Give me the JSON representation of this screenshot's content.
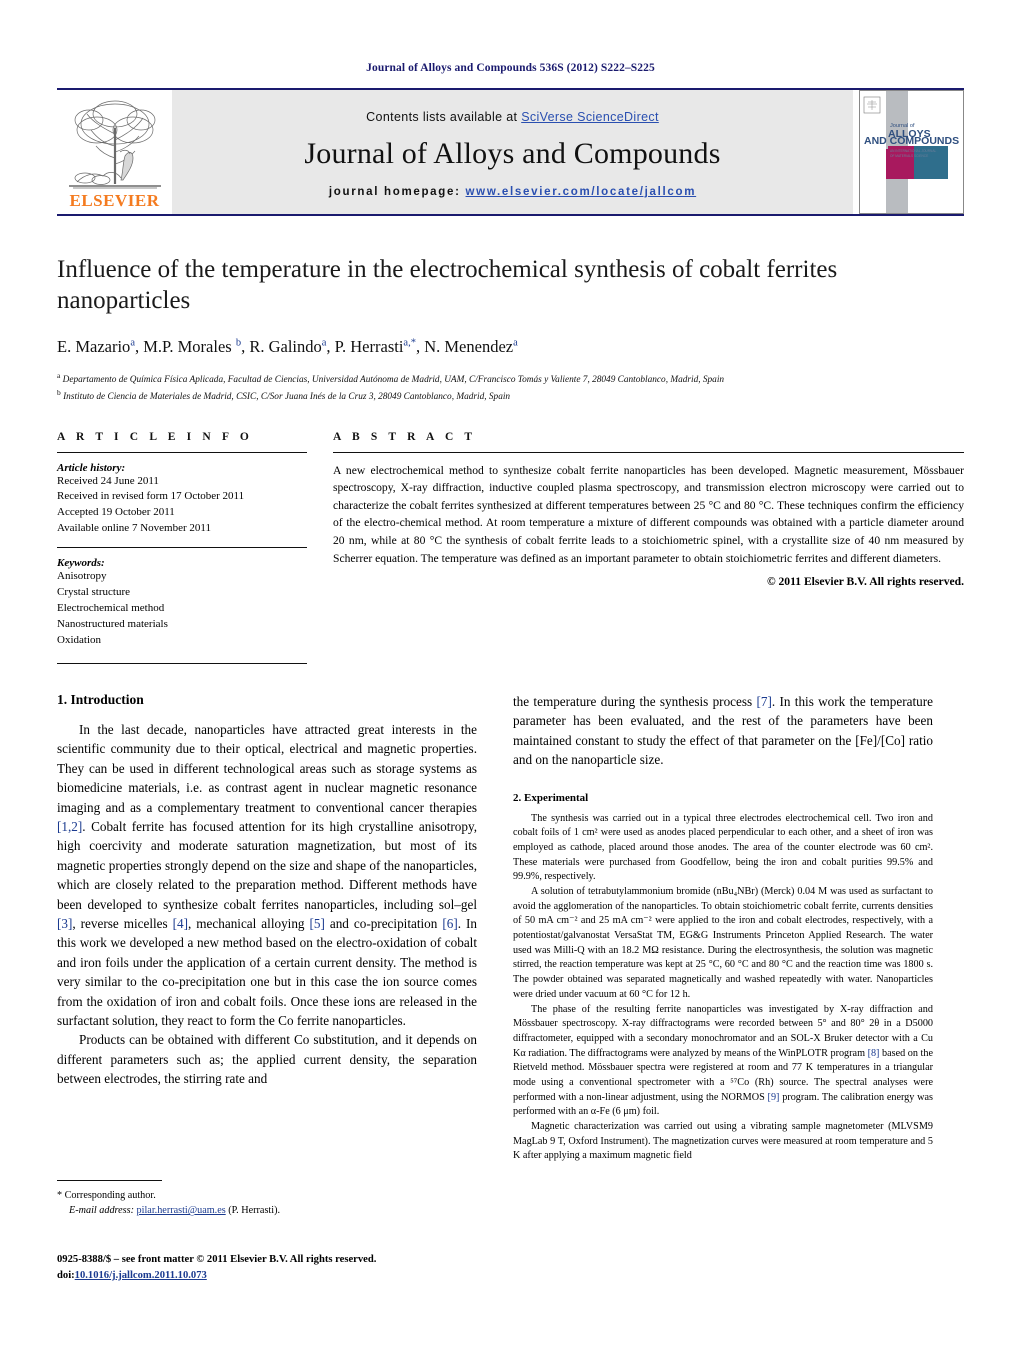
{
  "running_head": "Journal of Alloys and Compounds 536S (2012) S222–S225",
  "masthead": {
    "publisher_logo_word": "ELSEVIER",
    "contents_prefix": "Contents lists available at ",
    "contents_link": "SciVerse ScienceDirect",
    "journal_name": "Journal of Alloys and Compounds",
    "homepage_prefix": "journal homepage: ",
    "homepage_url": "www.elsevier.com/locate/jallcom",
    "cover": {
      "line1": "Journal of",
      "line2": "ALLOYS",
      "line3": "AND COMPOUNDS",
      "logo_word": "ELSEVIER"
    }
  },
  "article": {
    "title": "Influence of the temperature in the electrochemical synthesis of cobalt ferrites nanoparticles",
    "authors_html": "E. Mazario<sup>a</sup>, M.P. Morales <sup>b</sup>, R. Galindo<sup>a</sup>, P. Herrasti<sup>a,*</sup>, N. Menendez<sup>a</sup>",
    "affiliations": [
      "Departamento de Química Física Aplicada, Facultad de Ciencias, Universidad Autónoma de Madrid, UAM, C/Francisco Tomás y Valiente 7, 28049 Cantoblanco, Madrid, Spain",
      "Instituto de Ciencia de Materiales de Madrid, CSIC, C/Sor Juana Inés de la Cruz 3, 28049 Cantoblanco, Madrid, Spain"
    ],
    "affiliation_marks": [
      "a",
      "b"
    ]
  },
  "article_info": {
    "heading": "A R T I C L E    I N F O",
    "history_label": "Article history:",
    "history": [
      "Received 24 June 2011",
      "Received in revised form 17 October 2011",
      "Accepted 19 October 2011",
      "Available online 7 November 2011"
    ],
    "keywords_label": "Keywords:",
    "keywords": [
      "Anisotropy",
      "Crystal structure",
      "Electrochemical method",
      "Nanostructured materials",
      "Oxidation"
    ]
  },
  "abstract": {
    "heading": "A B S T R A C T",
    "text": "A new electrochemical method to synthesize cobalt ferrite nanoparticles has been developed. Magnetic measurement, Mössbauer spectroscopy, X-ray diffraction, inductive coupled plasma spectroscopy, and transmission electron microscopy were carried out to characterize the cobalt ferrites synthesized at different temperatures between 25 °C and 80 °C. These techniques confirm the efficiency of the electro-chemical method. At room temperature a mixture of different compounds was obtained with a particle diameter around 20 nm, while at 80 °C the synthesis of cobalt ferrite leads to a stoichiometric spinel, with a crystallite size of 40 nm measured by Scherrer equation. The temperature was defined as an important parameter to obtain stoichiometric ferrites and different diameters.",
    "copyright": "© 2011 Elsevier B.V. All rights reserved."
  },
  "sections": {
    "introduction_heading": "1.  Introduction",
    "intro_p1": "In the last decade, nanoparticles have attracted great interests in the scientific community due to their optical, electrical and magnetic properties. They can be used in different technological areas such as storage systems as biomedicine materials, i.e. as contrast agent in nuclear magnetic resonance imaging and as a complementary treatment to conventional cancer therapies [1,2]. Cobalt ferrite has focused attention for its high crystalline anisotropy, high coercivity and moderate saturation magnetization, but most of its magnetic properties strongly depend on the size and shape of the nanoparticles, which are closely related to the preparation method. Different methods have been developed to synthesize cobalt ferrites nanoparticles, including sol–gel [3], reverse micelles [4], mechanical alloying [5] and co-precipitation [6]. In this work we developed a new method based on the electro-oxidation of cobalt and iron foils under the application of a certain current density. The method is very similar to the co-precipitation one but in this case the ion source comes from the oxidation of iron and cobalt foils. Once these ions are released in the surfactant solution, they react to form the Co ferrite nanoparticles.",
    "intro_p2": "Products can be obtained with different Co substitution, and it depends on different parameters such as; the applied current density, the separation between electrodes, the stirring rate and",
    "intro_p3": "the temperature during the synthesis process [7]. In this work the temperature parameter has been evaluated, and the rest of the parameters have been maintained constant to study the effect of that parameter on the [Fe]/[Co] ratio and on the nanoparticle size.",
    "experimental_heading": "2.  Experimental",
    "exp_p1": "The synthesis was carried out in a typical three electrodes electrochemical cell. Two iron and cobalt foils of 1 cm² were used as anodes placed perpendicular to each other, and a sheet of iron was employed as cathode, placed around those anodes. The area of the counter electrode was 60 cm². These materials were purchased from Goodfellow, being the iron and cobalt purities 99.5% and 99.9%, respectively.",
    "exp_p2": "A solution of tetrabutylammonium bromide (nBu₄NBr) (Merck) 0.04 M was used as surfactant to avoid the agglomeration of the nanoparticles. To obtain stoichiometric cobalt ferrite, currents densities of 50 mA cm⁻² and 25 mA cm⁻² were applied to the iron and cobalt electrodes, respectively, with a potentiostat/galvanostat VersaStat TM, EG&G Instruments Princeton Applied Research. The water used was Milli-Q with an 18.2 MΩ resistance. During the electrosynthesis, the solution was magnetic stirred, the reaction temperature was kept at 25 °C, 60 °C and 80 °C and the reaction time was 1800 s. The powder obtained was separated magnetically and washed repeatedly with water. Nanoparticles were dried under vacuum at 60 °C for 12 h.",
    "exp_p3": "The phase of the resulting ferrite nanoparticles was investigated by X-ray diffraction and Mössbauer spectroscopy. X-ray diffractograms were recorded between 5° and 80° 2θ in a D5000 diffractometer, equipped with a secondary monochromator and an SOL-X Bruker detector with a Cu Kα radiation. The diffractograms were analyzed by means of the WinPLOTR program [8] based on the Rietveld method. Mössbauer spectra were registered at room and 77 K temperatures in a triangular mode using a conventional spectrometer with a ⁵⁷Co (Rh) source. The spectral analyses were performed with a non-linear adjustment, using the NORMOS [9] program. The calibration energy was performed with an α-Fe (6 μm) foil.",
    "exp_p4": "Magnetic characterization was carried out using a vibrating sample magnetometer (MLVSM9 MagLab 9 T, Oxford Instrument). The magnetization curves were measured at room temperature and 5 K after applying a maximum magnetic field"
  },
  "footnote": {
    "corresponding": "* Corresponding author.",
    "email_label": "E-mail address:",
    "email": "pilar.herrasti@uam.es",
    "email_suffix": " (P. Herrasti).",
    "issn_line": "0925-8388/$ – see front matter © 2011 Elsevier B.V. All rights reserved.",
    "doi_label": "doi:",
    "doi": "10.1016/j.jallcom.2011.10.073"
  },
  "colors": {
    "navy": "#1a1a6e",
    "link_blue": "#2a4fb0",
    "ref_blue": "#1a3a8f",
    "elsevier_orange": "#F47B20",
    "masthead_gray": "#e8e8e8",
    "cover_magenta": "#a8195e",
    "cover_teal": "#2f6e8c",
    "cover_gray": "#b9bcc0"
  }
}
